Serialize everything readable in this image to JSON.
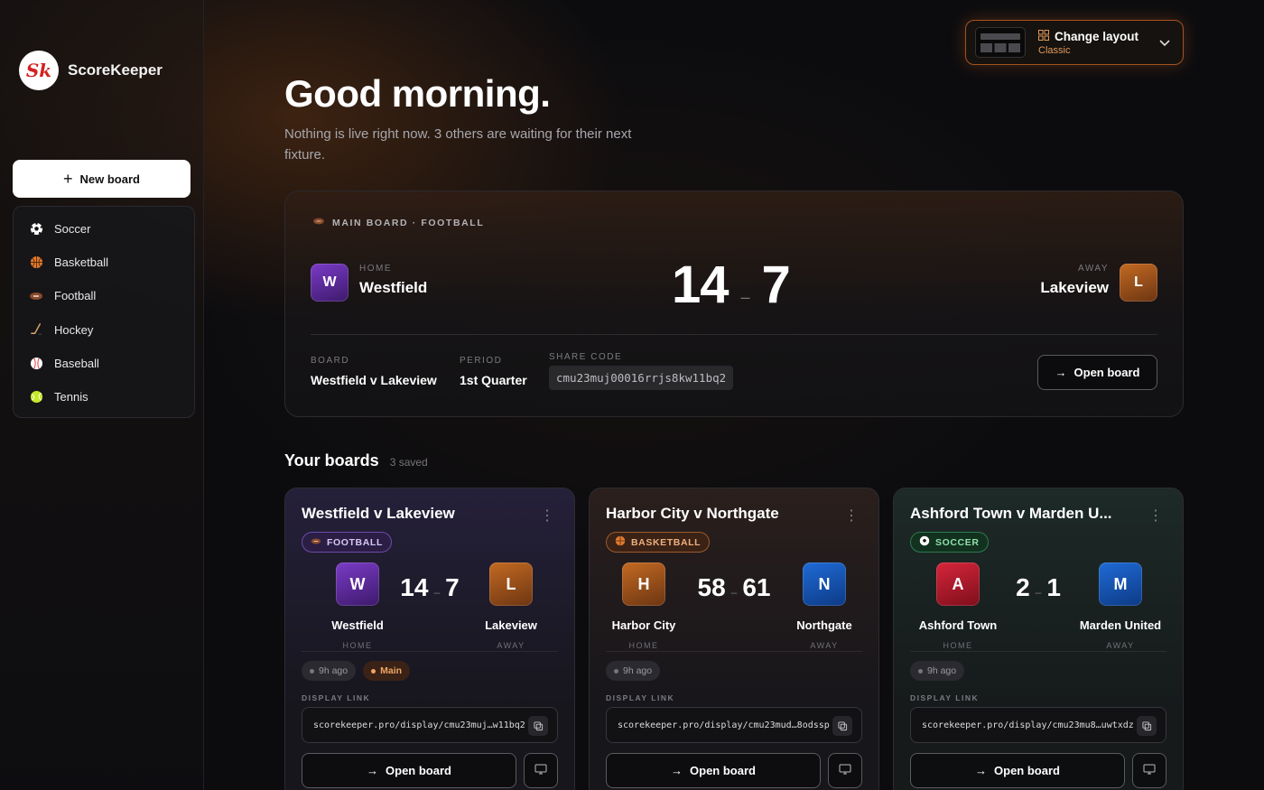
{
  "brand": {
    "name": "ScoreKeeper",
    "logo_text": "Sk"
  },
  "sidebar": {
    "new_board_label": "New board",
    "sports": [
      {
        "label": "Soccer",
        "icon": "soccer-ball-icon"
      },
      {
        "label": "Basketball",
        "icon": "basketball-icon"
      },
      {
        "label": "Football",
        "icon": "football-icon"
      },
      {
        "label": "Hockey",
        "icon": "hockey-stick-icon"
      },
      {
        "label": "Baseball",
        "icon": "baseball-icon"
      },
      {
        "label": "Tennis",
        "icon": "tennis-ball-icon"
      }
    ]
  },
  "layout_switch": {
    "title": "Change layout",
    "current": "Classic"
  },
  "greeting": {
    "title": "Good morning.",
    "subtitle": "Nothing is live right now. 3 others are waiting for their next fixture."
  },
  "main_board": {
    "label": "MAIN BOARD · FOOTBALL",
    "home": {
      "side": "HOME",
      "name": "Westfield",
      "initial": "W",
      "score": "14"
    },
    "away": {
      "side": "AWAY",
      "name": "Lakeview",
      "initial": "L",
      "score": "7"
    },
    "meta": {
      "board_key": "BOARD",
      "board_value": "Westfield v Lakeview",
      "period_key": "PERIOD",
      "period_value": "1st Quarter",
      "share_key": "SHARE CODE",
      "share_value": "cmu23muj00016rrjs8kw11bq2"
    },
    "open_label": "Open board"
  },
  "boards_section": {
    "title": "Your boards",
    "count": "3 saved"
  },
  "boards": [
    {
      "title": "Westfield v Lakeview",
      "sport": "FOOTBALL",
      "home": {
        "initial": "W",
        "name": "Westfield",
        "side": "HOME",
        "score": "14"
      },
      "away": {
        "initial": "L",
        "name": "Lakeview",
        "side": "AWAY",
        "score": "7"
      },
      "time": "9h ago",
      "badge": "Main",
      "display_label": "DISPLAY LINK",
      "display_link": "scorekeeper.pro/display/cmu23muj…w11bq2",
      "open_label": "Open board"
    },
    {
      "title": "Harbor City v Northgate",
      "sport": "BASKETBALL",
      "home": {
        "initial": "H",
        "name": "Harbor City",
        "side": "HOME",
        "score": "58"
      },
      "away": {
        "initial": "N",
        "name": "Northgate",
        "side": "AWAY",
        "score": "61"
      },
      "time": "9h ago",
      "display_label": "DISPLAY LINK",
      "display_link": "scorekeeper.pro/display/cmu23mud…8odssp",
      "open_label": "Open board"
    },
    {
      "title": "Ashford Town v Marden U...",
      "sport": "SOCCER",
      "home": {
        "initial": "A",
        "name": "Ashford Town",
        "side": "HOME",
        "score": "2"
      },
      "away": {
        "initial": "M",
        "name": "Marden United",
        "side": "AWAY",
        "score": "1"
      },
      "time": "9h ago",
      "display_label": "DISPLAY LINK",
      "display_link": "scorekeeper.pro/display/cmu23mu8…uwtxdz",
      "open_label": "Open board"
    }
  ],
  "colors": {
    "accent": "#e08a3f",
    "football": "#8a63d2",
    "basketball": "#e07b2f",
    "soccer": "#3fbf6f"
  }
}
